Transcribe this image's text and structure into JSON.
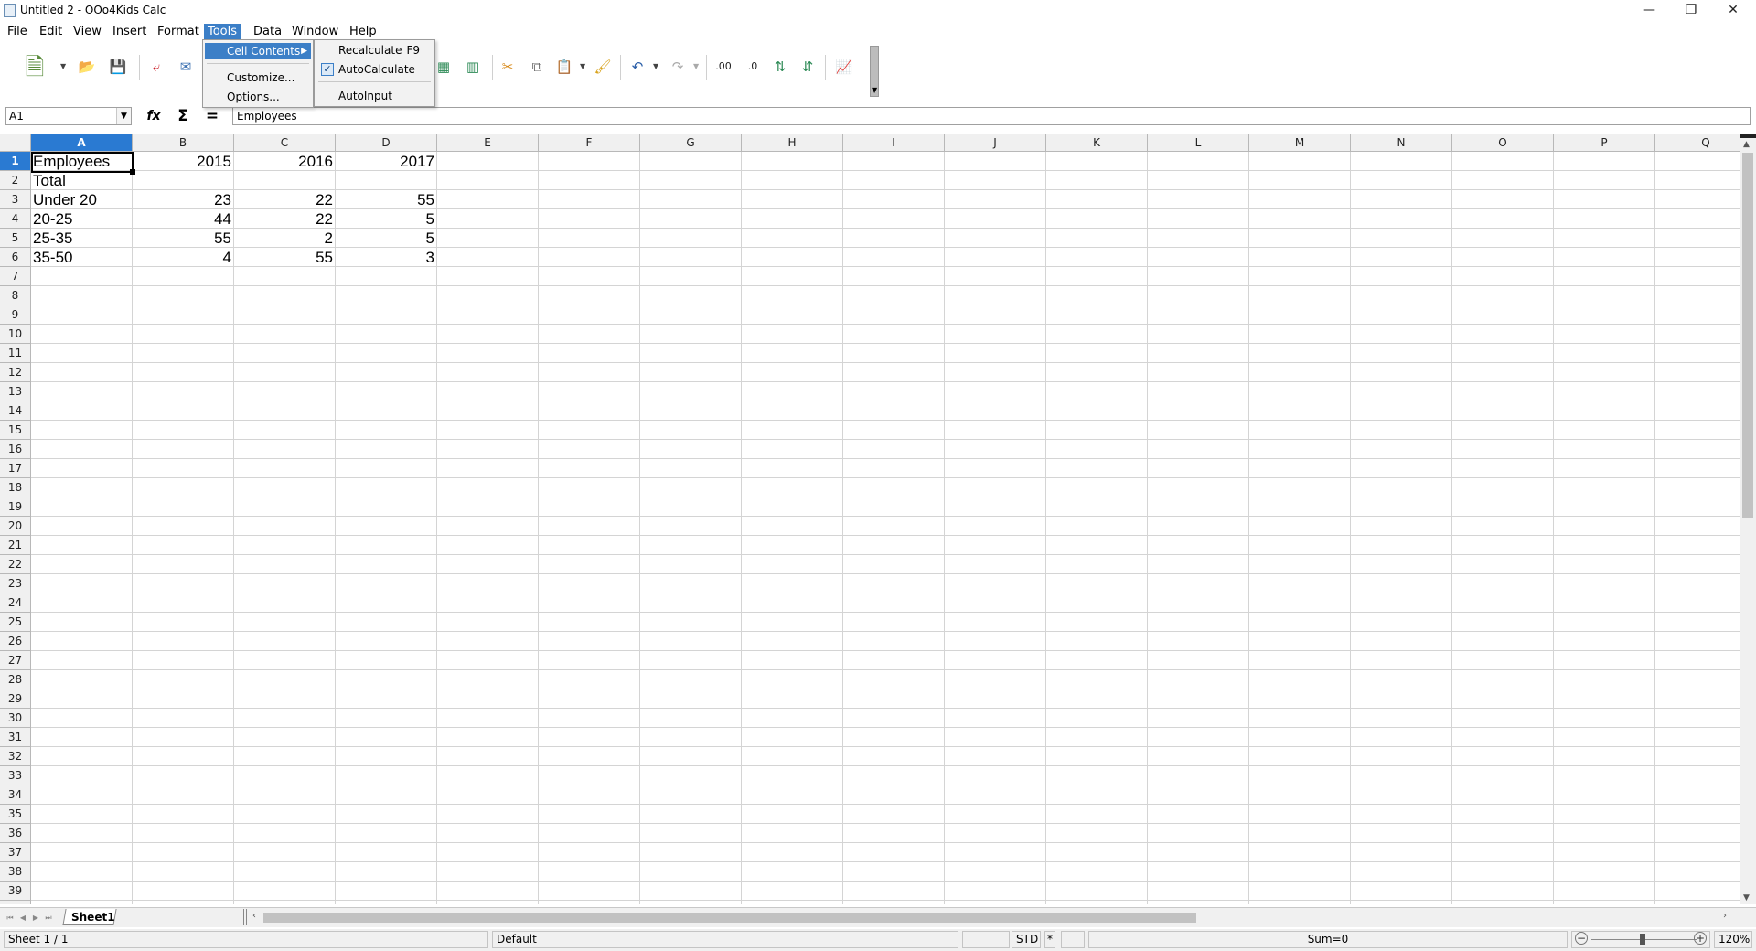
{
  "window": {
    "title": "Untitled 2 - OOo4Kids Calc",
    "minimize": "—",
    "restore": "❐",
    "close": "✕"
  },
  "menubar": {
    "items": [
      "File",
      "Edit",
      "View",
      "Insert",
      "Format",
      "Tools",
      "Data",
      "Window",
      "Help"
    ],
    "active": "Tools"
  },
  "tools_menu": {
    "items": [
      "Cell Contents",
      "Customize...",
      "Options..."
    ]
  },
  "cell_contents_submenu": {
    "recalculate": "Recalculate",
    "recalculate_shortcut": "F9",
    "autocalculate": "AutoCalculate",
    "autocalculate_checked": true,
    "autoinput": "AutoInput"
  },
  "formula_bar": {
    "name_box": "A1",
    "content": "Employees"
  },
  "grid": {
    "columns": [
      "A",
      "B",
      "C",
      "D",
      "E",
      "F",
      "G",
      "H",
      "I",
      "J",
      "K",
      "L",
      "M",
      "N",
      "O",
      "P",
      "Q"
    ],
    "selected_column": "A",
    "selected_row": 1,
    "row_count": 39,
    "cells": [
      [
        "Employees",
        "2015",
        "2016",
        "2017"
      ],
      [
        "Total",
        "",
        "",
        ""
      ],
      [
        "Under 20",
        "23",
        "22",
        "55"
      ],
      [
        "20-25",
        "44",
        "22",
        "5"
      ],
      [
        "25-35",
        "55",
        "2",
        "5"
      ],
      [
        "35-50",
        "4",
        "55",
        "3"
      ]
    ]
  },
  "sheet_tabs": {
    "tabs": [
      "Sheet1"
    ],
    "active": "Sheet1"
  },
  "statusbar": {
    "sheet": "Sheet 1 / 1",
    "page_style": "Default",
    "mode": "STD",
    "modified": "*",
    "sum": "Sum=0",
    "zoom": "120%",
    "zoom_level": 120
  }
}
